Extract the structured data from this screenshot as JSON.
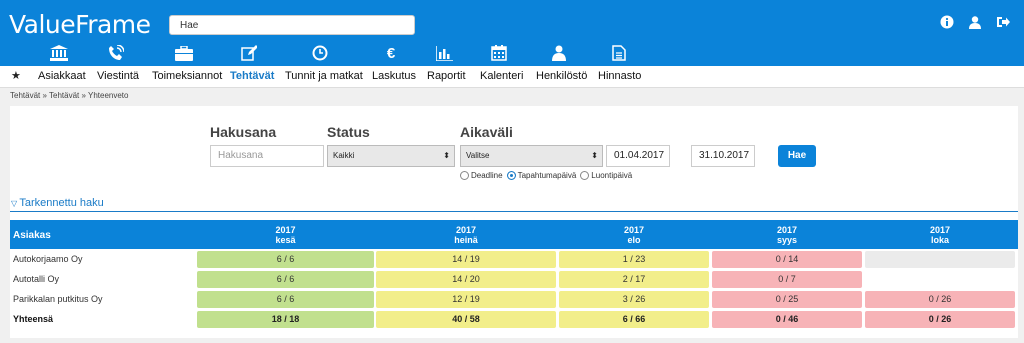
{
  "app": {
    "logo": "ValueFrame"
  },
  "search": {
    "value": "Hae"
  },
  "top_icons": [
    "info-icon",
    "user-icon",
    "logout-icon"
  ],
  "modules": [
    "bank-icon",
    "phone-icon",
    "briefcase-icon",
    "edit-icon",
    "clock-icon",
    "euro-icon",
    "chart-icon",
    "calendar-icon",
    "person-icon",
    "document-icon"
  ],
  "nav": {
    "items": [
      "Asiakkaat",
      "Viestintä",
      "Toimeksiannot",
      "Tehtävät",
      "Tunnit ja matkat",
      "Laskutus",
      "Raportit",
      "Kalenteri",
      "Henkilöstö",
      "Hinnasto"
    ],
    "active": "Tehtävät"
  },
  "breadcrumb": "Tehtävät  » Tehtävät  » Yhteenveto",
  "filters": {
    "hakusana_label": "Hakusana",
    "hakusana_placeholder": "Hakusana",
    "status_label": "Status",
    "status_value": "Kaikki",
    "aikavali_label": "Aikaväli",
    "aikavali_value": "Valitse",
    "date_from": "01.04.2017",
    "date_to": "31.10.2017",
    "search_button": "Hae",
    "radio_options": [
      "Deadline",
      "Tapahtumapäivä",
      "Luontipäivä"
    ],
    "radio_selected": "Tapahtumapäivä"
  },
  "advanced_search": "Tarkennettu haku",
  "table": {
    "first_col": "Asiakas",
    "columns": [
      {
        "year": "2017",
        "month": "kesä"
      },
      {
        "year": "2017",
        "month": "heinä"
      },
      {
        "year": "2017",
        "month": "elo"
      },
      {
        "year": "2017",
        "month": "syys"
      },
      {
        "year": "2017",
        "month": "loka"
      }
    ],
    "rows": [
      {
        "name": "Autokorjaamo Oy",
        "cells": [
          {
            "v": "6 / 6",
            "c": "green"
          },
          {
            "v": "14 / 19",
            "c": "yellow"
          },
          {
            "v": "1 / 23",
            "c": "yellow"
          },
          {
            "v": "0 / 14",
            "c": "red"
          },
          {
            "v": "",
            "c": "empty"
          }
        ]
      },
      {
        "name": "Autotalli Oy",
        "cells": [
          {
            "v": "6 / 6",
            "c": "green"
          },
          {
            "v": "14 / 20",
            "c": "yellow"
          },
          {
            "v": "2 / 17",
            "c": "yellow"
          },
          {
            "v": "0 / 7",
            "c": "red"
          },
          {
            "v": "",
            "c": "none"
          }
        ]
      },
      {
        "name": "Parikkalan putkitus Oy",
        "cells": [
          {
            "v": "6 / 6",
            "c": "green"
          },
          {
            "v": "12 / 19",
            "c": "yellow"
          },
          {
            "v": "3 / 26",
            "c": "yellow"
          },
          {
            "v": "0 / 25",
            "c": "red"
          },
          {
            "v": "0 / 26",
            "c": "red"
          }
        ]
      },
      {
        "name": "Yhteensä",
        "cells": [
          {
            "v": "18 / 18",
            "c": "green"
          },
          {
            "v": "40 / 58",
            "c": "yellow"
          },
          {
            "v": "6 / 66",
            "c": "yellow"
          },
          {
            "v": "0 / 46",
            "c": "red"
          },
          {
            "v": "0 / 26",
            "c": "red"
          }
        ]
      }
    ]
  },
  "colors": {
    "brand": "#0b83d9",
    "green": "#c1e08e",
    "yellow": "#f2ee8a",
    "red": "#f7b3b7",
    "empty": "#ebebeb"
  }
}
